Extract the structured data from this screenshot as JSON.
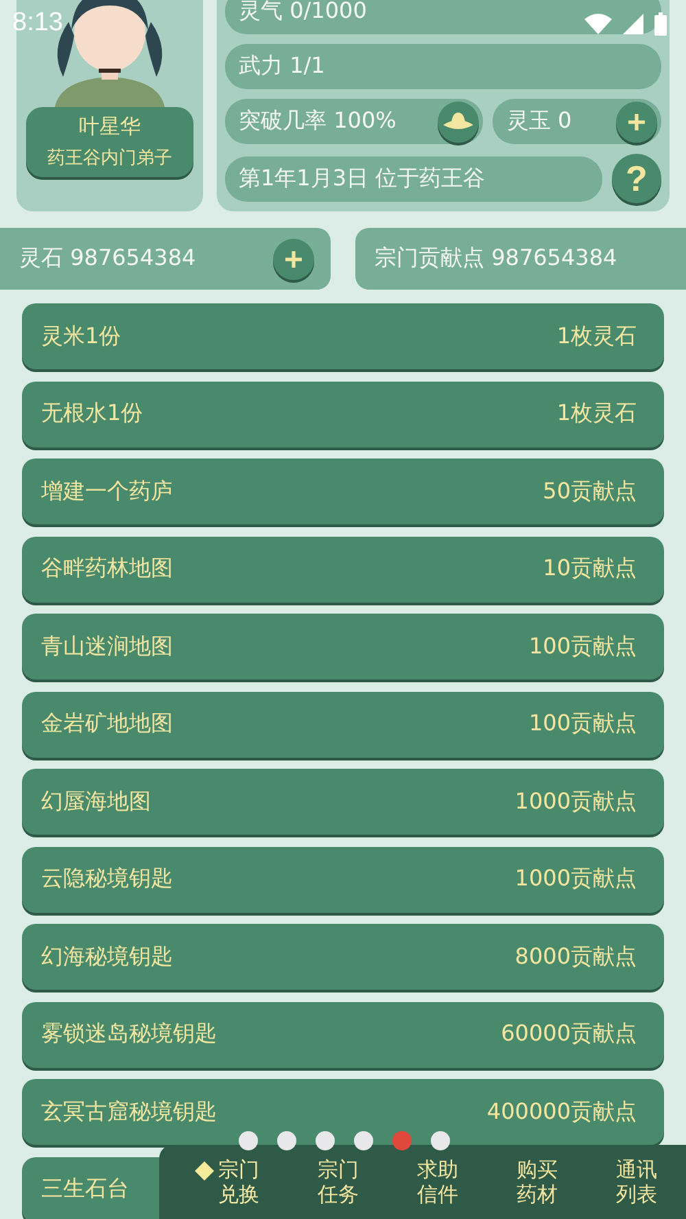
{
  "status_bar": {
    "time": "8:13"
  },
  "profile": {
    "name": "叶星华",
    "title": "药王谷内门弟子"
  },
  "stats": {
    "spirit": "灵气 0/1000",
    "force": "武力 1/1",
    "breakthrough": "突破几率 100%",
    "jade": "灵玉 0",
    "date": "第1年1月3日 位于药王谷",
    "help": "?"
  },
  "resources": [
    {
      "label": "灵石 987654384",
      "has_add": true
    },
    {
      "label": "宗门贡献点 987654384",
      "has_add": false
    }
  ],
  "items": [
    {
      "name": "灵米1份",
      "price": "1枚灵石"
    },
    {
      "name": "无根水1份",
      "price": "1枚灵石"
    },
    {
      "name": "增建一个药庐",
      "price": "50贡献点"
    },
    {
      "name": "谷畔药林地图",
      "price": "10贡献点"
    },
    {
      "name": "青山迷涧地图",
      "price": "100贡献点"
    },
    {
      "name": "金岩矿地地图",
      "price": "100贡献点"
    },
    {
      "name": "幻蜃海地图",
      "price": "1000贡献点"
    },
    {
      "name": "云隐秘境钥匙",
      "price": "1000贡献点"
    },
    {
      "name": "幻海秘境钥匙",
      "price": "8000贡献点"
    },
    {
      "name": "雾锁迷岛秘境钥匙",
      "price": "60000贡献点"
    },
    {
      "name": "玄冥古窟秘境钥匙",
      "price": "400000贡献点"
    },
    {
      "name": "三生石台"
    }
  ],
  "nav": [
    {
      "label": "宗门兑换",
      "selected": true
    },
    {
      "label": "宗门任务",
      "selected": false
    },
    {
      "label": "求助信件",
      "selected": false
    },
    {
      "label": "购买药材",
      "selected": false
    },
    {
      "label": "通讯列表",
      "selected": false
    }
  ],
  "page_dots": [
    {
      "selected": false
    },
    {
      "selected": false
    },
    {
      "selected": false
    },
    {
      "selected": false
    },
    {
      "selected": true
    },
    {
      "selected": false
    }
  ]
}
